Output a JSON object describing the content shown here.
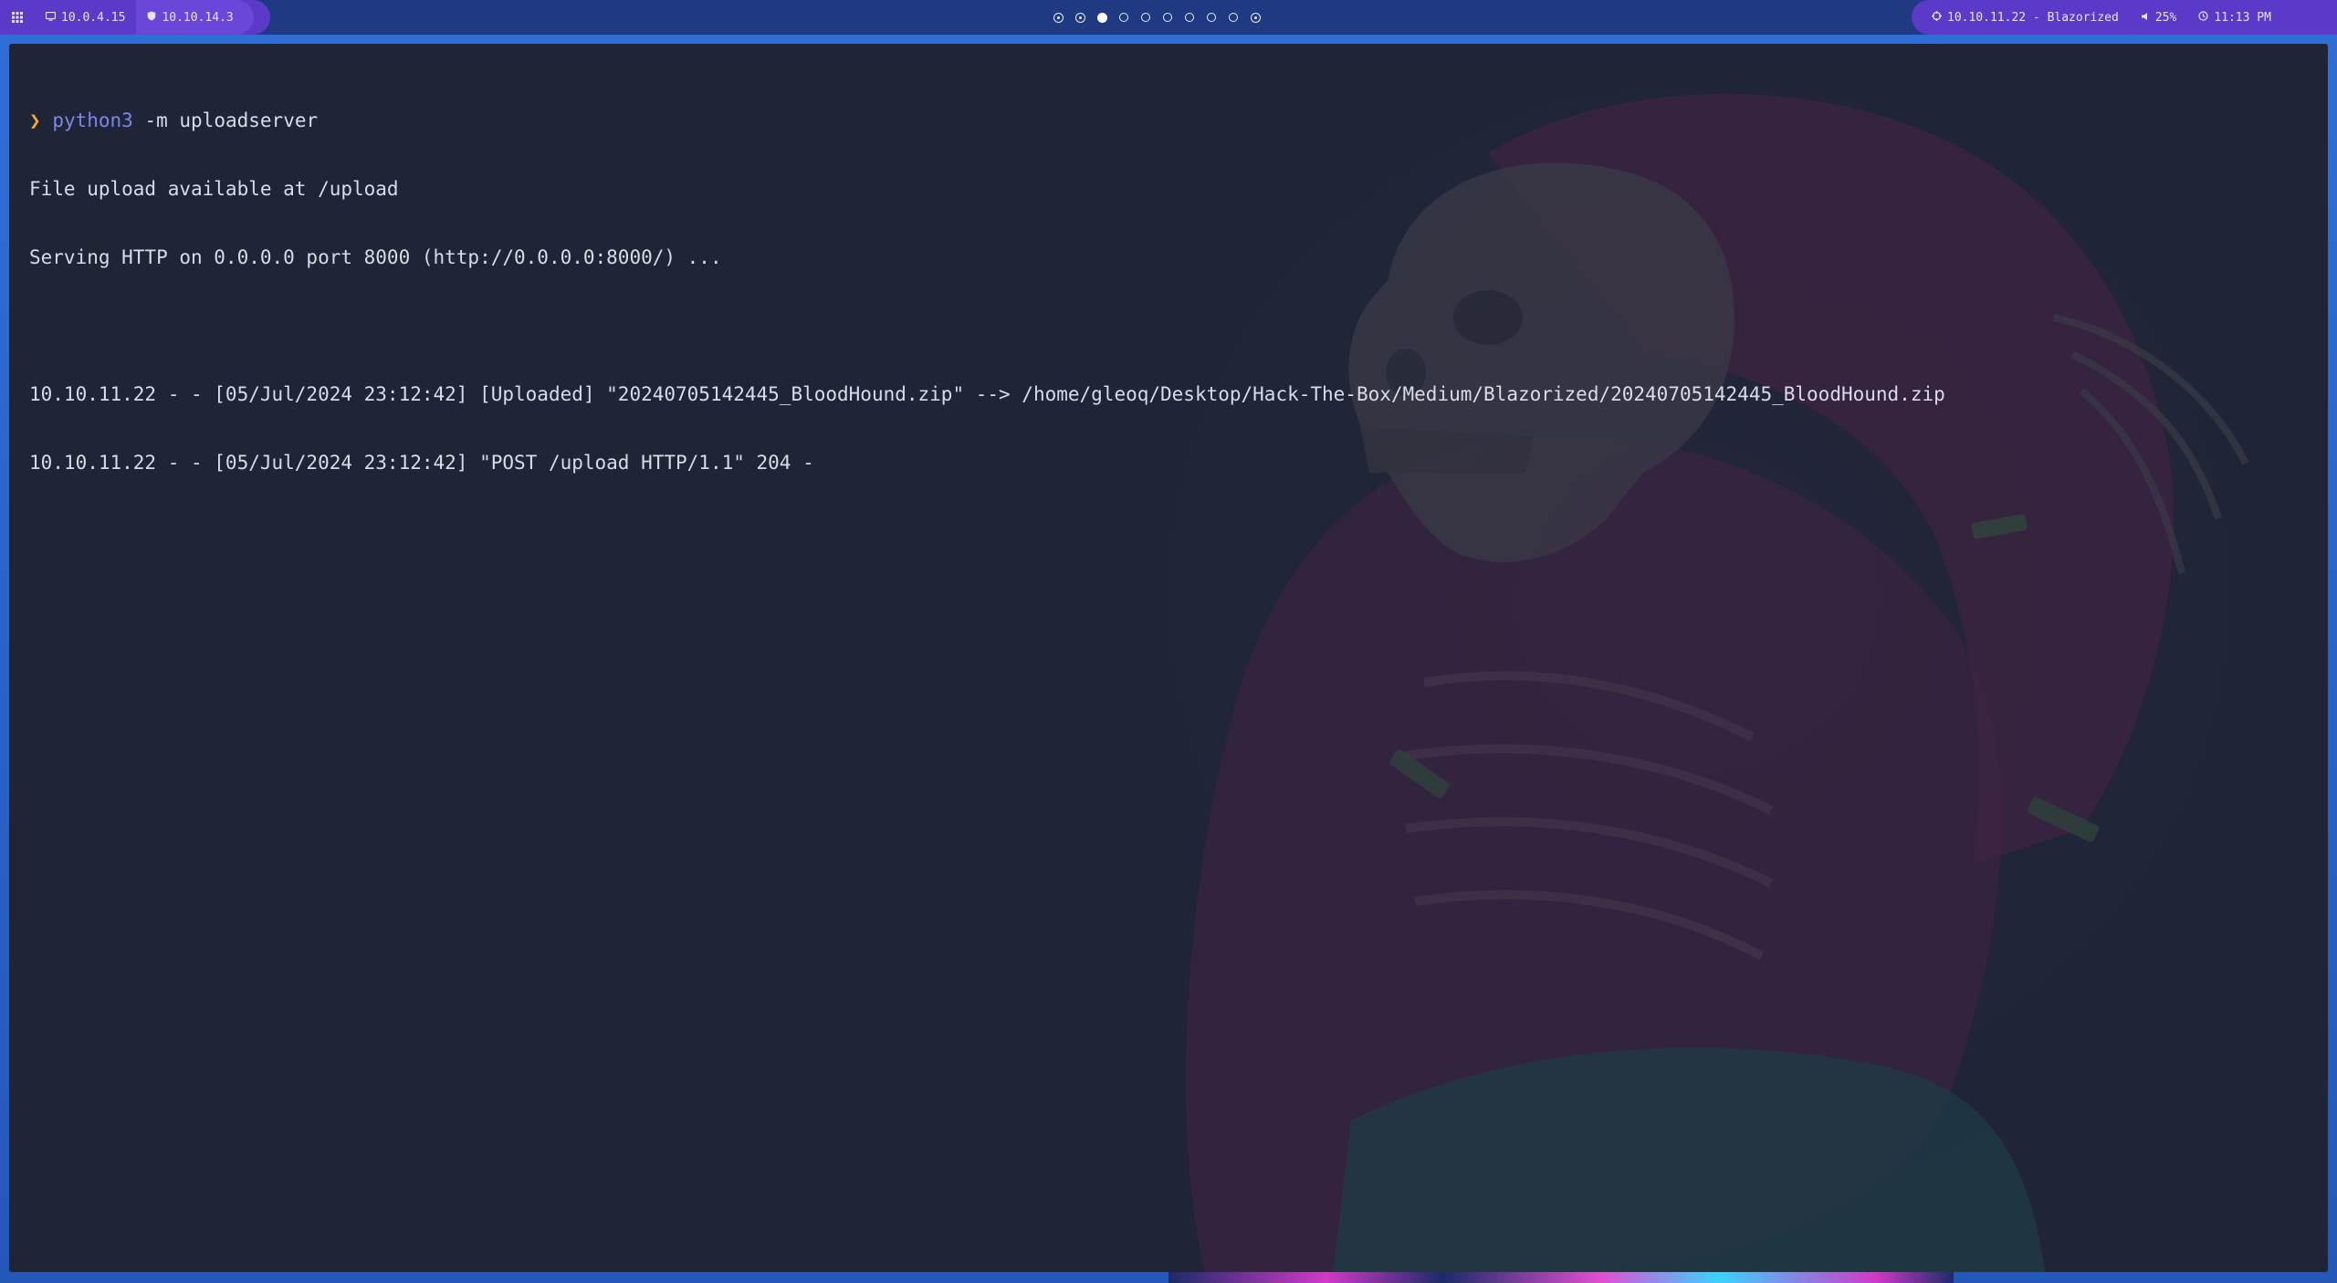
{
  "topbar": {
    "left": {
      "menu_icon": "grid-menu-icon",
      "local_ip": "10.0.4.15",
      "local_ip_icon": "monitor-icon",
      "vpn_ip": "10.10.14.3",
      "vpn_ip_icon": "shield-icon"
    },
    "workspaces": [
      {
        "state": "occupied"
      },
      {
        "state": "occupied"
      },
      {
        "state": "active"
      },
      {
        "state": "empty"
      },
      {
        "state": "empty"
      },
      {
        "state": "empty"
      },
      {
        "state": "empty"
      },
      {
        "state": "empty"
      },
      {
        "state": "empty"
      },
      {
        "state": "occupied"
      }
    ],
    "right": {
      "target": "10.10.11.22 - Blazorized",
      "target_icon": "target-icon",
      "volume": "25%",
      "volume_icon": "speaker-icon",
      "clock": "11:13 PM",
      "clock_icon": "clock-icon"
    },
    "colors": {
      "bar": "#1f3a82",
      "pill": "#5b39c9",
      "workspace_active": "#ffffff"
    }
  },
  "terminal": {
    "prompt_symbol": "❯",
    "command": "python3",
    "command_args": " -m uploadserver",
    "output": [
      "File upload available at /upload",
      "Serving HTTP on 0.0.0.0 port 8000 (http://0.0.0.0:8000/) ...",
      "",
      "10.10.11.22 - - [05/Jul/2024 23:12:42] [Uploaded] \"20240705142445_BloodHound.zip\" --> /home/gleoq/Desktop/Hack-The-Box/Medium/Blazorized/20240705142445_BloodHound.zip",
      "10.10.11.22 - - [05/Jul/2024 23:12:42] \"POST /upload HTTP/1.1\" 204 -"
    ],
    "colors": {
      "background": "#1f2537",
      "text": "#d9dce6",
      "prompt": "#f0a93c",
      "command": "#7b86e8"
    }
  }
}
